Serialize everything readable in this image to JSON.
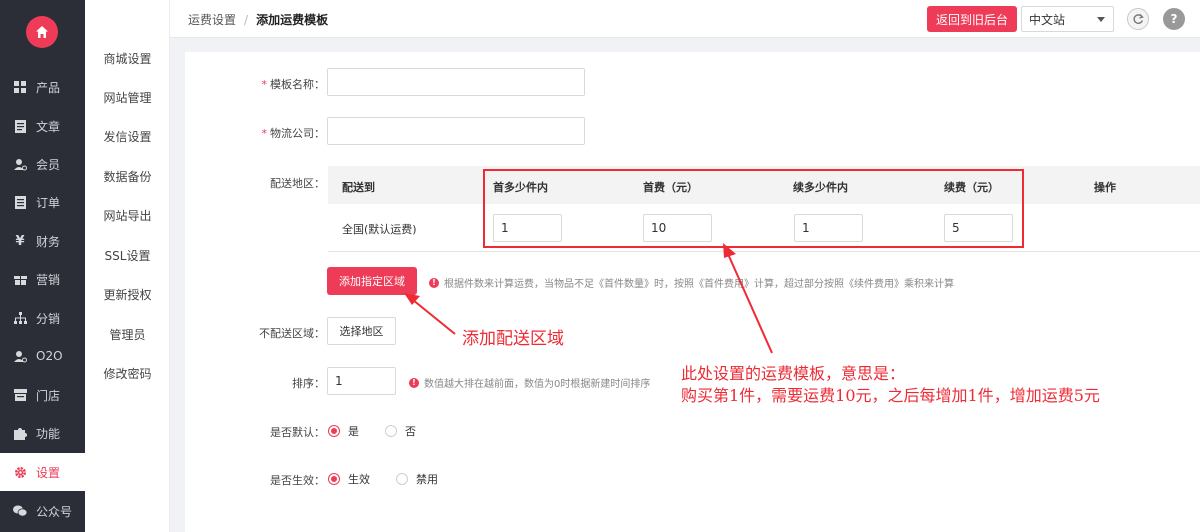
{
  "sidebar": {
    "items": [
      {
        "label": "产品",
        "icon": "grid-icon"
      },
      {
        "label": "文章",
        "icon": "document-icon"
      },
      {
        "label": "会员",
        "icon": "user-icon"
      },
      {
        "label": "订单",
        "icon": "list-icon"
      },
      {
        "label": "财务",
        "icon": "yen-icon"
      },
      {
        "label": "营销",
        "icon": "gift-icon"
      },
      {
        "label": "分销",
        "icon": "sitemap-icon"
      },
      {
        "label": "O2O",
        "icon": "user-o2o-icon"
      },
      {
        "label": "门店",
        "icon": "store-icon"
      },
      {
        "label": "功能",
        "icon": "puzzle-icon"
      },
      {
        "label": "设置",
        "icon": "gear-icon",
        "active": true
      },
      {
        "label": "公众号",
        "icon": "wechat-icon"
      }
    ]
  },
  "submenu": {
    "items": [
      "商城设置",
      "网站管理",
      "发信设置",
      "数据备份",
      "网站导出",
      "SSL设置",
      "更新授权",
      "管理员",
      "修改密码"
    ]
  },
  "header": {
    "breadcrumb_parent": "运费设置",
    "breadcrumb_sep": "/",
    "breadcrumb_current": "添加运费模板",
    "back_button": "返回到旧后台",
    "language": "中文站"
  },
  "form": {
    "template_name_label": "模板名称：",
    "template_name_value": "",
    "logistics_label": "物流公司：",
    "logistics_value": "",
    "area_label": "配送地区：",
    "table": {
      "headers": [
        "配送到",
        "首多少件内",
        "首费（元）",
        "续多少件内",
        "续费（元）",
        "操作"
      ],
      "row": {
        "region": "全国(默认运费)",
        "first_count": "1",
        "first_fee": "10",
        "extra_count": "1",
        "extra_fee": "5"
      }
    },
    "add_region_button": "添加指定区域",
    "add_region_hint": "根据件数来计算运费，当物品不足《首件数量》时，按照《首件费用》计算，超过部分按照《续件费用》乘积来计算",
    "no_delivery_label": "不配送区域：",
    "select_region_button": "选择地区",
    "sort_label": "排序：",
    "sort_value": "1",
    "sort_hint": "数值越大排在越前面，数值为0时根据新建时间排序",
    "default_label": "是否默认：",
    "default_yes": "是",
    "default_no": "否",
    "default_selected": "是",
    "active_label": "是否生效：",
    "active_yes": "生效",
    "active_no": "禁用",
    "active_selected": "生效"
  },
  "annotations": {
    "add_region_note": "添加配送区域",
    "template_note_line1": "此处设置的运费模板，意思是：",
    "template_note_line2": "购买第1件，需要运费10元，之后每增加1件，增加运费5元"
  },
  "colors": {
    "accent": "#ee3b57",
    "sidebar_bg": "#2b2d37",
    "annotation_red": "#ee2b35"
  }
}
